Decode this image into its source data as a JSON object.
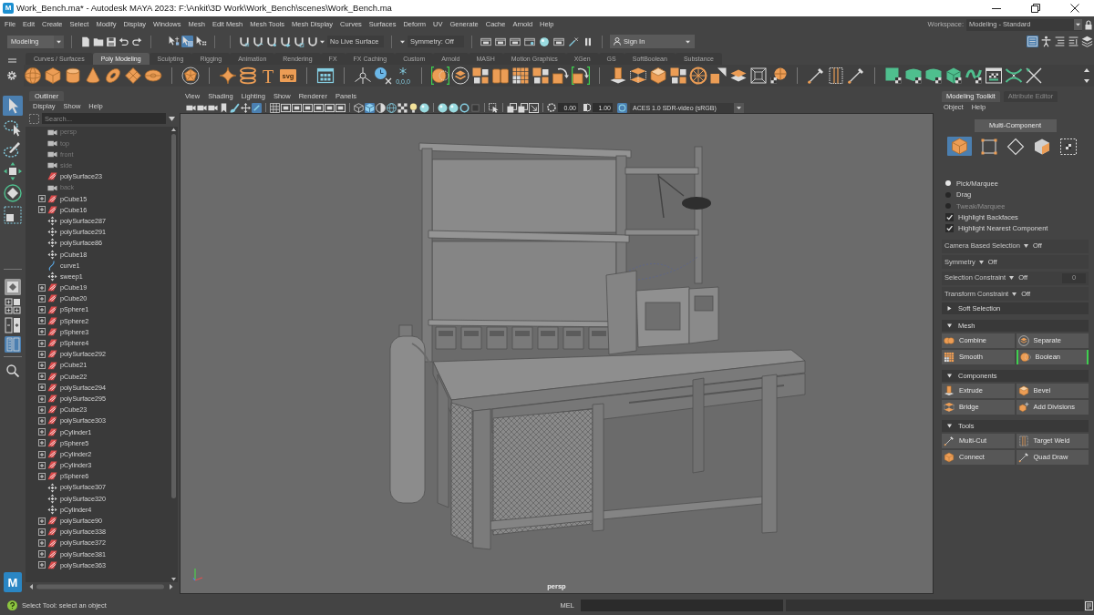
{
  "title_bar": {
    "app_letter": "M",
    "title": "Work_Bench.ma* - Autodesk MAYA 2023: F:\\Ankit\\3D Work\\Work_Bench\\scenes\\Work_Bench.ma"
  },
  "menu_bar": {
    "items": [
      "File",
      "Edit",
      "Create",
      "Select",
      "Modify",
      "Display",
      "Windows",
      "Mesh",
      "Edit Mesh",
      "Mesh Tools",
      "Mesh Display",
      "Curves",
      "Surfaces",
      "Deform",
      "UV",
      "Generate",
      "Cache",
      "Arnold",
      "Help"
    ],
    "workspace_label": "Workspace:",
    "workspace": "Modeling - Standard"
  },
  "status_line": {
    "menu_set": "Modeling",
    "select_modes": [
      {
        "kind": "hierarchy",
        "selected": false
      },
      {
        "kind": "object",
        "selected": true
      },
      {
        "kind": "component",
        "selected": false
      }
    ],
    "live_surface": "No Live Surface",
    "symmetry": "Symmetry: Off",
    "sign_in": "Sign In",
    "panel_toggles": [
      {
        "kind": "attributes",
        "selected": true
      },
      {
        "kind": "figure",
        "selected": false
      },
      {
        "kind": "list",
        "selected": false
      },
      {
        "kind": "outline",
        "selected": false
      },
      {
        "kind": "stack",
        "selected": false
      }
    ]
  },
  "shelf": {
    "tabs": [
      {
        "label": "Curves / Surfaces",
        "selected": false
      },
      {
        "label": "Poly Modeling",
        "selected": true
      },
      {
        "label": "Sculpting",
        "selected": false
      },
      {
        "label": "Rigging",
        "selected": false
      },
      {
        "label": "Animation",
        "selected": false
      },
      {
        "label": "Rendering",
        "selected": false
      },
      {
        "label": "FX",
        "selected": false
      },
      {
        "label": "FX Caching",
        "selected": false
      },
      {
        "label": "Custom",
        "selected": false
      },
      {
        "label": "Arnold",
        "selected": false
      },
      {
        "label": "MASH",
        "selected": false
      },
      {
        "label": "Motion Graphics",
        "selected": false
      },
      {
        "label": "XGen",
        "selected": false
      },
      {
        "label": "GS",
        "selected": false
      },
      {
        "label": "SoftBoolean",
        "selected": false
      },
      {
        "label": "Substance",
        "selected": false
      }
    ],
    "groups": [
      {
        "buttons": [
          {
            "kind": "sphere",
            "active": false
          },
          {
            "kind": "cube",
            "active": false
          },
          {
            "kind": "cylinder",
            "active": false
          },
          {
            "kind": "cone",
            "active": false
          },
          {
            "kind": "torus",
            "active": false
          },
          {
            "kind": "plane",
            "active": false
          },
          {
            "kind": "disc",
            "active": false
          }
        ]
      },
      {
        "buttons": [
          {
            "kind": "polyhedron",
            "active": false
          }
        ]
      },
      {
        "buttons": [
          {
            "kind": "star",
            "active": false
          },
          {
            "kind": "helix",
            "active": false
          },
          {
            "kind": "type",
            "label": "T",
            "active": false
          },
          {
            "kind": "svg",
            "label": "svg",
            "active": false
          }
        ]
      },
      {
        "buttons": [
          {
            "kind": "window",
            "active": false
          }
        ]
      },
      {
        "buttons": [
          {
            "kind": "pivot",
            "active": false
          },
          {
            "kind": "clock",
            "active": false
          },
          {
            "kind": "coords",
            "label": "0,0,0",
            "active": false
          }
        ]
      },
      {
        "buttons": [
          {
            "kind": "boolean",
            "active": true
          },
          {
            "kind": "layers",
            "active": false
          },
          {
            "kind": "squares",
            "active": false
          },
          {
            "kind": "cube_pair",
            "active": false
          },
          {
            "kind": "grid",
            "active": false
          },
          {
            "kind": "squares",
            "active": false
          },
          {
            "kind": "arrows_box",
            "active": false
          },
          {
            "kind": "arrows_box",
            "active": true
          }
        ]
      },
      {
        "buttons": [
          {
            "kind": "extrude",
            "active": false
          },
          {
            "kind": "bridge",
            "active": false
          },
          {
            "kind": "bevel",
            "active": false
          },
          {
            "kind": "squares",
            "active": false
          },
          {
            "kind": "wheel",
            "active": false
          },
          {
            "kind": "slice",
            "active": false
          },
          {
            "kind": "planes",
            "active": false
          },
          {
            "kind": "frame",
            "active": false
          },
          {
            "kind": "grid_ball",
            "active": false
          }
        ]
      },
      {
        "buttons": [
          {
            "kind": "pen",
            "active": false
          },
          {
            "kind": "weld",
            "active": false
          },
          {
            "kind": "pen",
            "active": false
          }
        ]
      },
      {
        "buttons": [
          {
            "kind": "uv_square",
            "active": false
          },
          {
            "kind": "uv_shape",
            "active": false
          },
          {
            "kind": "uv_shape",
            "active": false
          },
          {
            "kind": "uv_cube",
            "active": false
          },
          {
            "kind": "uv_wave",
            "active": false
          },
          {
            "kind": "uv_grid",
            "active": false
          },
          {
            "kind": "uv_cross",
            "active": false
          },
          {
            "kind": "uv_knife",
            "active": false
          }
        ]
      }
    ]
  },
  "toolbox": {
    "logo": "M",
    "tools": [
      {
        "kind": "select",
        "selected": true
      },
      {
        "kind": "lasso",
        "selected": false
      },
      {
        "kind": "paint",
        "selected": false
      },
      {
        "kind": "move",
        "selected": false
      },
      {
        "kind": "rotate",
        "selected": false
      },
      {
        "kind": "scale",
        "selected": false
      }
    ],
    "layouts": [
      {
        "kind": "single",
        "selected": false
      },
      {
        "kind": "four",
        "selected": false
      },
      {
        "kind": "two",
        "selected": false
      },
      {
        "kind": "outliner",
        "selected": true
      }
    ]
  },
  "outliner": {
    "title": "Outliner",
    "menu": [
      "Display",
      "Show",
      "Help"
    ],
    "search": {
      "placeholder": "Search..."
    },
    "items": [
      {
        "name": "persp",
        "kind": "camera",
        "expandable": false,
        "hidden": true
      },
      {
        "name": "top",
        "kind": "camera",
        "expandable": false,
        "hidden": true
      },
      {
        "name": "front",
        "kind": "camera",
        "expandable": false,
        "hidden": true
      },
      {
        "name": "side",
        "kind": "camera",
        "expandable": false,
        "hidden": true
      },
      {
        "name": "polySurface23",
        "kind": "mesh",
        "expandable": false,
        "hidden": false
      },
      {
        "name": "back",
        "kind": "camera",
        "expandable": false,
        "hidden": true
      },
      {
        "name": "pCube15",
        "kind": "mesh",
        "expandable": true,
        "hidden": false
      },
      {
        "name": "pCube16",
        "kind": "mesh",
        "expandable": true,
        "hidden": false
      },
      {
        "name": "polySurface287",
        "kind": "transform",
        "expandable": false,
        "hidden": false
      },
      {
        "name": "polySurface291",
        "kind": "transform",
        "expandable": false,
        "hidden": false
      },
      {
        "name": "polySurface86",
        "kind": "transform",
        "expandable": false,
        "hidden": false
      },
      {
        "name": "pCube18",
        "kind": "transform",
        "expandable": false,
        "hidden": false
      },
      {
        "name": "curve1",
        "kind": "curve",
        "expandable": false,
        "hidden": false
      },
      {
        "name": "sweep1",
        "kind": "transform",
        "expandable": false,
        "hidden": false
      },
      {
        "name": "pCube19",
        "kind": "mesh",
        "expandable": true,
        "hidden": false
      },
      {
        "name": "pCube20",
        "kind": "mesh",
        "expandable": true,
        "hidden": false
      },
      {
        "name": "pSphere1",
        "kind": "mesh",
        "expandable": true,
        "hidden": false
      },
      {
        "name": "pSphere2",
        "kind": "mesh",
        "expandable": true,
        "hidden": false
      },
      {
        "name": "pSphere3",
        "kind": "mesh",
        "expandable": true,
        "hidden": false
      },
      {
        "name": "pSphere4",
        "kind": "mesh",
        "expandable": true,
        "hidden": false
      },
      {
        "name": "polySurface292",
        "kind": "mesh",
        "expandable": true,
        "hidden": false
      },
      {
        "name": "pCube21",
        "kind": "mesh",
        "expandable": true,
        "hidden": false
      },
      {
        "name": "pCube22",
        "kind": "mesh",
        "expandable": true,
        "hidden": false
      },
      {
        "name": "polySurface294",
        "kind": "mesh",
        "expandable": true,
        "hidden": false
      },
      {
        "name": "polySurface295",
        "kind": "mesh",
        "expandable": true,
        "hidden": false
      },
      {
        "name": "pCube23",
        "kind": "mesh",
        "expandable": true,
        "hidden": false
      },
      {
        "name": "polySurface303",
        "kind": "mesh",
        "expandable": true,
        "hidden": false
      },
      {
        "name": "pCylinder1",
        "kind": "mesh",
        "expandable": true,
        "hidden": false
      },
      {
        "name": "pSphere5",
        "kind": "mesh",
        "expandable": true,
        "hidden": false
      },
      {
        "name": "pCylinder2",
        "kind": "mesh",
        "expandable": true,
        "hidden": false
      },
      {
        "name": "pCylinder3",
        "kind": "mesh",
        "expandable": true,
        "hidden": false
      },
      {
        "name": "pSphere6",
        "kind": "mesh",
        "expandable": true,
        "hidden": false
      },
      {
        "name": "polySurface307",
        "kind": "transform",
        "expandable": false,
        "hidden": false
      },
      {
        "name": "polySurface320",
        "kind": "transform",
        "expandable": false,
        "hidden": false
      },
      {
        "name": "pCylinder4",
        "kind": "transform",
        "expandable": false,
        "hidden": false
      },
      {
        "name": "polySurface90",
        "kind": "mesh",
        "expandable": true,
        "hidden": false
      },
      {
        "name": "polySurface338",
        "kind": "mesh",
        "expandable": true,
        "hidden": false
      },
      {
        "name": "polySurface372",
        "kind": "mesh",
        "expandable": true,
        "hidden": false
      },
      {
        "name": "polySurface381",
        "kind": "mesh",
        "expandable": true,
        "hidden": false
      },
      {
        "name": "polySurface363",
        "kind": "mesh",
        "expandable": true,
        "hidden": false
      }
    ]
  },
  "viewport": {
    "menu": [
      "View",
      "Shading",
      "Lighting",
      "Show",
      "Renderer",
      "Panels"
    ],
    "toolbar": [
      {
        "tools": [
          {
            "kind": "camera",
            "on": false
          },
          {
            "kind": "camera",
            "on": false
          },
          {
            "kind": "camera",
            "on": false
          },
          {
            "kind": "bookmark",
            "on": false
          },
          {
            "kind": "brush",
            "on": false
          },
          {
            "kind": "move",
            "on": false
          },
          {
            "kind": "pencil",
            "on": true
          }
        ]
      },
      {
        "tools": [
          {
            "kind": "grid",
            "on": false
          },
          {
            "kind": "gate",
            "on": false
          },
          {
            "kind": "gate",
            "on": false
          },
          {
            "kind": "gate",
            "on": false
          },
          {
            "kind": "gate",
            "on": false
          },
          {
            "kind": "gate",
            "on": false
          },
          {
            "kind": "gate",
            "on": false
          }
        ]
      },
      {
        "tools": [
          {
            "kind": "cube_wire",
            "on": false
          },
          {
            "kind": "cube_shaded",
            "on": true
          },
          {
            "kind": "sphere_half",
            "on": false
          },
          {
            "kind": "sphere_wire",
            "on": false
          },
          {
            "kind": "checker",
            "on": false
          },
          {
            "kind": "bulb",
            "on": false
          },
          {
            "kind": "ball",
            "on": false
          }
        ]
      },
      {
        "tools": [
          {
            "kind": "ball",
            "on": false
          },
          {
            "kind": "ball",
            "on": false
          },
          {
            "kind": "ring",
            "on": false
          },
          {
            "kind": "box_dark",
            "on": false
          }
        ]
      },
      {
        "tools": [
          {
            "kind": "select",
            "on": false
          }
        ]
      },
      {
        "tools": [
          {
            "kind": "squares",
            "on": false
          },
          {
            "kind": "squares",
            "on": false
          },
          {
            "kind": "square_arrow",
            "on": false
          }
        ]
      }
    ],
    "exposure": "0.00",
    "gamma": "1.00",
    "color_management": {
      "on": true
    },
    "color_space": "ACES 1.0 SDR-video (sRGB)",
    "camera": "persp"
  },
  "toolkit": {
    "tabs": [
      {
        "label": "Modeling Toolkit",
        "selected": true
      },
      {
        "label": "Attribute Editor",
        "selected": false
      }
    ],
    "menu": [
      "Object",
      "Help"
    ],
    "mode": "Multi-Component",
    "components": [
      {
        "kind": "object",
        "selected": true
      },
      {
        "kind": "vertex",
        "selected": false
      },
      {
        "kind": "edge",
        "selected": false
      },
      {
        "kind": "face",
        "selected": false
      },
      {
        "kind": "uv",
        "selected": false
      }
    ],
    "pick_modes": [
      {
        "label": "Pick/Marquee",
        "selected": true,
        "disabled": false
      },
      {
        "label": "Drag",
        "selected": false,
        "disabled": false
      },
      {
        "label": "Tweak/Marquee",
        "selected": false,
        "disabled": true
      }
    ],
    "options": [
      {
        "label": "Highlight Backfaces",
        "checked": true
      },
      {
        "label": "Highlight Nearest Component",
        "checked": true
      }
    ],
    "settings": [
      {
        "label": "Camera Based Selection",
        "value": "Off"
      },
      {
        "label": "Symmetry",
        "value": "Off"
      },
      {
        "label": "Selection Constraint",
        "value": "Off",
        "field": {
          "value": "0",
          "disabled": true
        }
      },
      {
        "label": "Transform Constraint",
        "value": "Off"
      }
    ],
    "sections": [
      {
        "title": "Soft Selection",
        "expanded": false
      },
      {
        "title": "Mesh",
        "expanded": true,
        "buttons": [
          {
            "label": "Combine",
            "kind": "combine",
            "active": false
          },
          {
            "label": "Separate",
            "kind": "separate",
            "active": false
          },
          {
            "label": "Smooth",
            "kind": "smooth",
            "active": false
          },
          {
            "label": "Boolean",
            "kind": "boolean",
            "active": true
          }
        ]
      },
      {
        "title": "Components",
        "expanded": true,
        "buttons": [
          {
            "label": "Extrude",
            "kind": "extrude",
            "active": false
          },
          {
            "label": "Bevel",
            "kind": "bevel",
            "active": false
          },
          {
            "label": "Bridge",
            "kind": "bridge",
            "active": false
          },
          {
            "label": "Add Divisions",
            "kind": "add_divisions",
            "active": false
          }
        ]
      },
      {
        "title": "Tools",
        "expanded": true,
        "buttons": [
          {
            "label": "Multi-Cut",
            "kind": "multi_cut",
            "active": false
          },
          {
            "label": "Target Weld",
            "kind": "target_weld",
            "active": false
          },
          {
            "label": "Connect",
            "kind": "connect",
            "active": false
          },
          {
            "label": "Quad Draw",
            "kind": "quad_draw",
            "active": false
          }
        ]
      }
    ]
  },
  "help_line": {
    "text": "Select Tool: select an object"
  },
  "command_line": {
    "language": "MEL"
  }
}
